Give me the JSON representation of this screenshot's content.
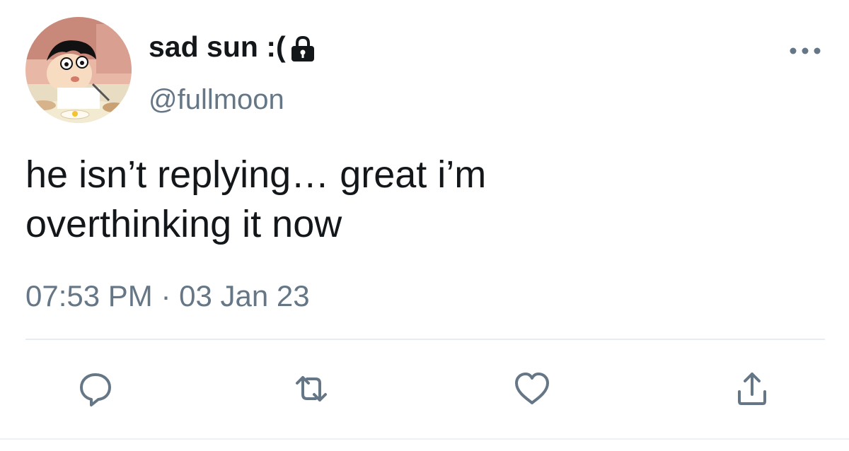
{
  "tweet": {
    "display_name": "sad sun :(",
    "handle": "@fullmoon",
    "text": "he isn’t replying… great i’m\noverthinking it now",
    "timestamp": "07:53 PM · 03 Jan 23",
    "protected": true
  },
  "icons": {
    "lock": "lock-icon",
    "more": "more-icon",
    "reply": "reply-icon",
    "retweet": "retweet-icon",
    "like": "heart-icon",
    "share": "share-icon"
  },
  "colors": {
    "text": "#14171a",
    "secondary": "#657786",
    "icon": "#657786",
    "divider": "#e6ecf0"
  }
}
